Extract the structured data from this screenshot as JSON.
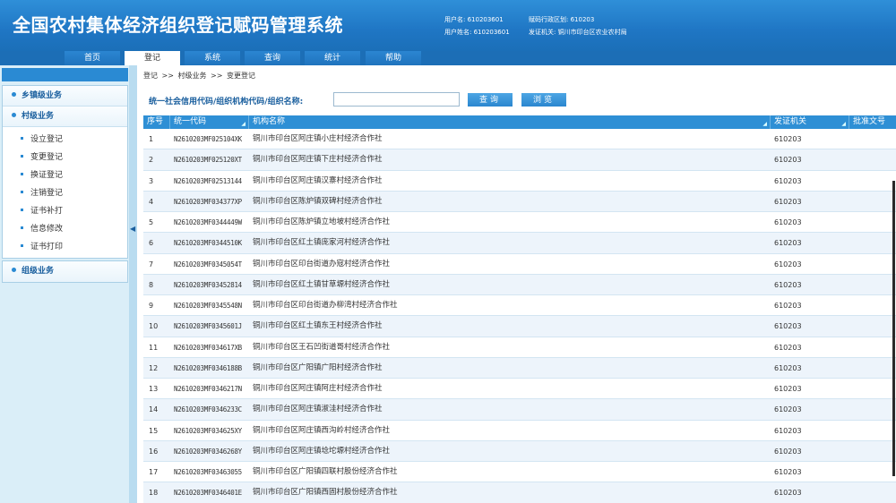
{
  "header": {
    "title": "全国农村集体经济组织登记赋码管理系统",
    "user_code_label": "用户名: 610203601",
    "user_name_label": "用户姓名: 610203601",
    "region_label": "赋码行政区划: 610203",
    "agency_label": "发证机关: 铜川市印台区农业农村局"
  },
  "nav": {
    "tabs": [
      "首页",
      "登记",
      "系统",
      "查询",
      "统计",
      "帮助"
    ],
    "active": "登记"
  },
  "sidebar": {
    "sections": [
      {
        "label": "乡镇级业务"
      },
      {
        "label": "村级业务"
      },
      {
        "label": "组级业务"
      }
    ],
    "village_items": [
      "设立登记",
      "变更登记",
      "换证登记",
      "注销登记",
      "证书补打",
      "信息修改",
      "证书打印"
    ]
  },
  "breadcrumb": [
    "登记",
    ">>",
    "村级业务",
    ">>",
    "变更登记"
  ],
  "search": {
    "label": "统一社会信用代码/组织机构代码/组织名称:",
    "value": "",
    "placeholder": "",
    "query_button": "查询",
    "browse_button": "浏览"
  },
  "table": {
    "columns": [
      "序号",
      "统一代码",
      "机构名称",
      "发证机关",
      "批准文号"
    ],
    "rows": [
      {
        "no": "1",
        "code": "N2610203MF025104XK",
        "name": "铜川市印台区阿庄镇小庄村经济合作社",
        "agency": "610203",
        "approval": ""
      },
      {
        "no": "2",
        "code": "N2610203MF025120XT",
        "name": "铜川市印台区阿庄镇下庄村经济合作社",
        "agency": "610203",
        "approval": ""
      },
      {
        "no": "3",
        "code": "N2610203MF02513144",
        "name": "铜川市印台区阿庄镇汉寨村经济合作社",
        "agency": "610203",
        "approval": ""
      },
      {
        "no": "4",
        "code": "N2610203MF034377XP",
        "name": "铜川市印台区陈炉镇双碑村经济合作社",
        "agency": "610203",
        "approval": ""
      },
      {
        "no": "5",
        "code": "N2610203MF0344449W",
        "name": "铜川市印台区陈炉镇立地坡村经济合作社",
        "agency": "610203",
        "approval": ""
      },
      {
        "no": "6",
        "code": "N2610203MF0344510K",
        "name": "铜川市印台区红土镇庞家河村经济合作社",
        "agency": "610203",
        "approval": ""
      },
      {
        "no": "7",
        "code": "N2610203MF0345054T",
        "name": "铜川市印台区印台街道办寇村经济合作社",
        "agency": "610203",
        "approval": ""
      },
      {
        "no": "8",
        "code": "N2610203MF03452814",
        "name": "铜川市印台区红土镇甘草塬村经济合作社",
        "agency": "610203",
        "approval": ""
      },
      {
        "no": "9",
        "code": "N2610203MF0345548N",
        "name": "铜川市印台区印台街道办柳湾村经济合作社",
        "agency": "610203",
        "approval": ""
      },
      {
        "no": "10",
        "code": "N2610203MF0345601J",
        "name": "铜川市印台区红土镇东王村经济合作社",
        "agency": "610203",
        "approval": ""
      },
      {
        "no": "11",
        "code": "N2610203MF034617XB",
        "name": "铜川市印台区王石凹街道哥村经济合作社",
        "agency": "610203",
        "approval": ""
      },
      {
        "no": "12",
        "code": "N2610203MF0346188B",
        "name": "铜川市印台区广阳镇广阳村经济合作社",
        "agency": "610203",
        "approval": ""
      },
      {
        "no": "13",
        "code": "N2610203MF0346217N",
        "name": "铜川市印台区阿庄镇阿庄村经济合作社",
        "agency": "610203",
        "approval": ""
      },
      {
        "no": "14",
        "code": "N2610203MF0346233C",
        "name": "铜川市印台区阿庄镇淑洼村经济合作社",
        "agency": "610203",
        "approval": ""
      },
      {
        "no": "15",
        "code": "N2610203MF034625XY",
        "name": "铜川市印台区阿庄镇西沟岭村经济合作社",
        "agency": "610203",
        "approval": ""
      },
      {
        "no": "16",
        "code": "N2610203MF0346268Y",
        "name": "铜川市印台区阿庄镇埝坨塬村经济合作社",
        "agency": "610203",
        "approval": ""
      },
      {
        "no": "17",
        "code": "N2610203MF03463055",
        "name": "铜川市印台区广阳镇四联村股份经济合作社",
        "agency": "610203",
        "approval": ""
      },
      {
        "no": "18",
        "code": "N2610203MF0346401E",
        "name": "铜川市印台区广阳镇西固村股份经济合作社",
        "agency": "610203",
        "approval": ""
      }
    ]
  },
  "colors": {
    "header_blue": "#1f76c4",
    "table_head": "#2e8fd5",
    "row_alt": "#edf4fb",
    "sidebar_bg": "#daeef8"
  }
}
